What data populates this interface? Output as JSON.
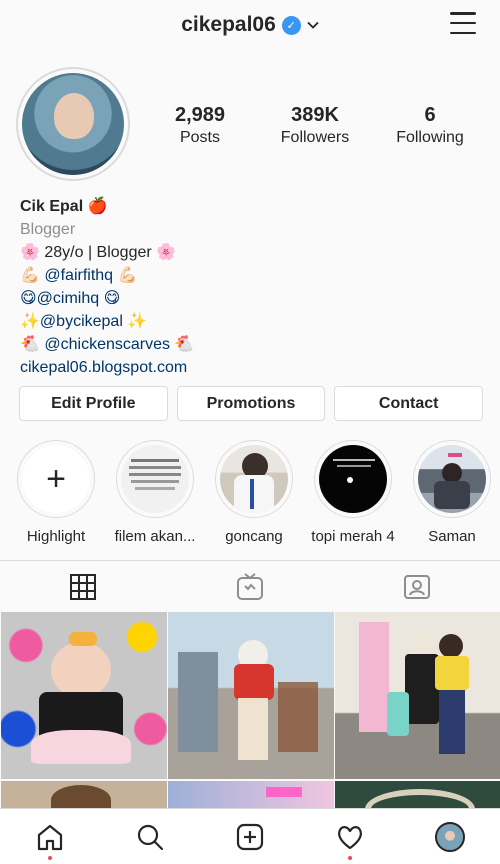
{
  "header": {
    "username": "cikepal06"
  },
  "profile": {
    "stats": [
      {
        "value": "2,989",
        "label": "Posts"
      },
      {
        "value": "389K",
        "label": "Followers"
      },
      {
        "value": "6",
        "label": "Following"
      }
    ],
    "name": "Cik Epal 🍎",
    "category": "Blogger",
    "bio_lines": [
      "🌸 28y/o | Blogger 🌸",
      "💪🏻 @fairfithq 💪🏻",
      "😋@cimihq 😋",
      "✨@bycikepal ✨",
      "🐔 @chickenscarves 🐔"
    ],
    "website": "cikepal06.blogspot.com"
  },
  "buttons": {
    "edit_profile": "Edit Profile",
    "promotions": "Promotions",
    "contact": "Contact"
  },
  "highlights": [
    {
      "label": "Highlight"
    },
    {
      "label": "filem akan..."
    },
    {
      "label": "goncang"
    },
    {
      "label": "topi merah 4"
    },
    {
      "label": "Saman"
    }
  ],
  "colors": {
    "accent": "#3897f0",
    "link": "#003569",
    "notification_dot": "#ed4956",
    "border": "#dbdbdb"
  }
}
